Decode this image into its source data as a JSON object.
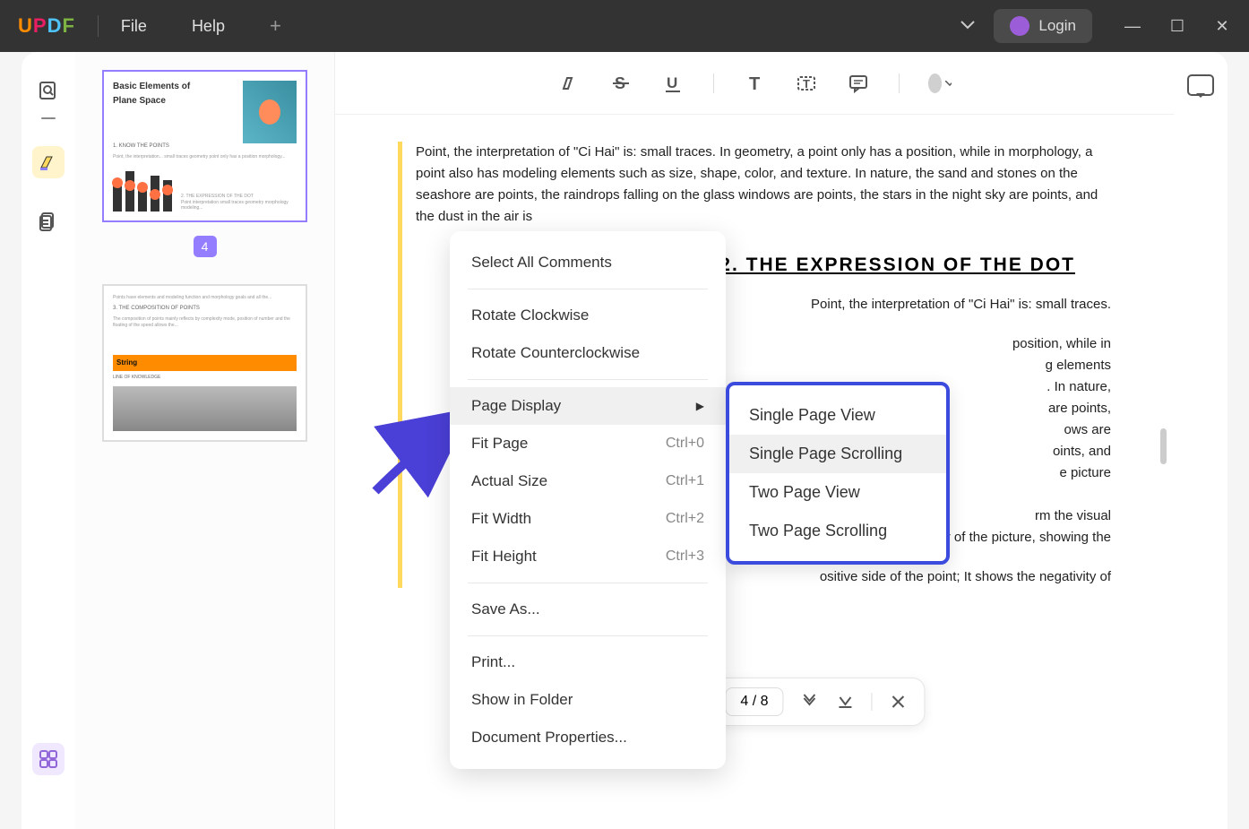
{
  "titlebar": {
    "logo": {
      "u": "U",
      "p": "P",
      "d": "D",
      "f": "F"
    },
    "menus": {
      "file": "File",
      "help": "Help"
    },
    "login": "Login"
  },
  "thumbnails": {
    "page4_number": "4",
    "page4_title_line1": "Basic Elements of",
    "page4_title_line2": "Plane Space",
    "page5_heading": "String"
  },
  "toolbar": {},
  "document": {
    "paragraph1": "Point, the interpretation of \"Ci Hai\" is: small traces. In geometry, a point only has a position, while in morphology, a point also has modeling elements such as size, shape, color, and texture. In nature, the sand and stones on the seashore are points, the raindrops falling on the glass windows are points, the stars in the night sky are points, and the dust in the air is",
    "heading": "2. THE EXPRESSION   OF THE DOT",
    "paragraph2a": "Point, the interpretation of \"Ci Hai\" is: small traces.",
    "paragraph2b": "position, while in",
    "paragraph2c": "g elements",
    "paragraph2d": ". In nature,",
    "paragraph2e": "are points,",
    "paragraph2f": "ows are",
    "paragraph2g": "oints, and",
    "paragraph2h": "e picture",
    "paragraph3a": "rm the visual",
    "paragraph3b": "ocus and the center of the picture, showing the",
    "paragraph3c": "ositive side of the point; It shows the negativity of"
  },
  "context_menu": {
    "select_all_comments": "Select All Comments",
    "rotate_cw": "Rotate Clockwise",
    "rotate_ccw": "Rotate Counterclockwise",
    "page_display": "Page Display",
    "fit_page": "Fit Page",
    "fit_page_shortcut": "Ctrl+0",
    "actual_size": "Actual Size",
    "actual_size_shortcut": "Ctrl+1",
    "fit_width": "Fit Width",
    "fit_width_shortcut": "Ctrl+2",
    "fit_height": "Fit Height",
    "fit_height_shortcut": "Ctrl+3",
    "save_as": "Save As...",
    "print": "Print...",
    "show_in_folder": "Show in Folder",
    "document_properties": "Document Properties..."
  },
  "submenu": {
    "single_page_view": "Single Page View",
    "single_page_scrolling": "Single Page Scrolling",
    "two_page_view": "Two Page View",
    "two_page_scrolling": "Two Page Scrolling"
  },
  "bottom_bar": {
    "page_indicator": "4 / 8"
  }
}
